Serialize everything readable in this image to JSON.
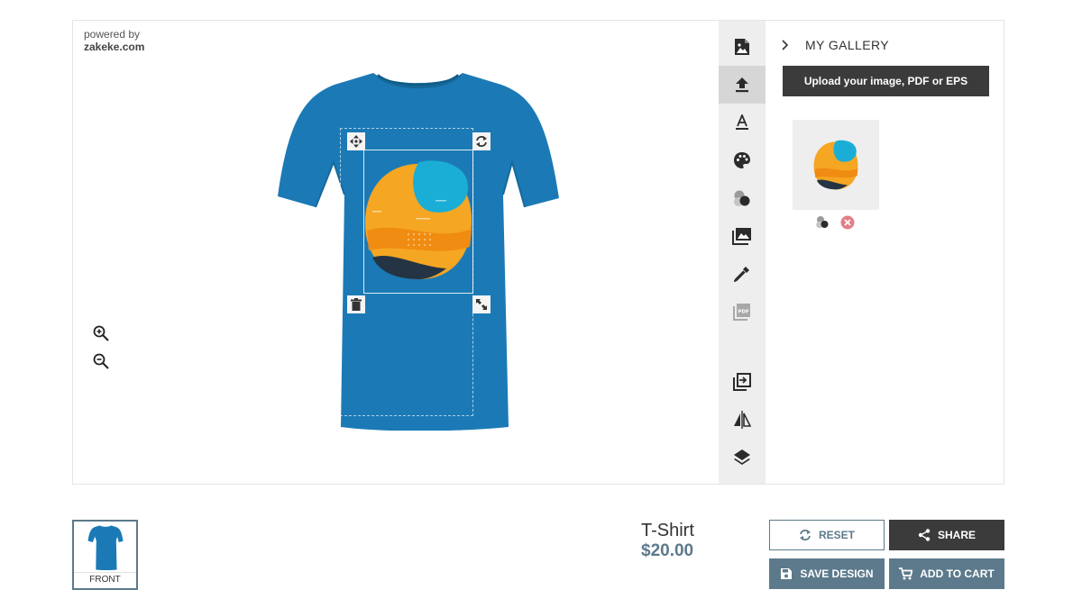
{
  "branding": {
    "powered_by": "powered by",
    "brand": "zakeke.com"
  },
  "colors": {
    "shirt": "#1b7ab6",
    "accent": "#5c7a8c",
    "dark": "#3b3b3b",
    "toolbar_bg": "#eeeeee",
    "art_orange": "#f5a623",
    "art_cyan": "#1aaed6",
    "art_navy": "#243444"
  },
  "editor": {
    "handles": [
      "move-icon",
      "rotate-icon",
      "delete-icon",
      "scale-icon"
    ],
    "zoom": [
      "zoom-in-icon",
      "zoom-out-icon"
    ]
  },
  "toolbar": {
    "tools": [
      {
        "name": "image-icon",
        "active": false
      },
      {
        "name": "upload-icon",
        "active": true
      },
      {
        "name": "text-icon",
        "active": false
      },
      {
        "name": "palette-icon",
        "active": false
      },
      {
        "name": "color-layers-icon",
        "active": false
      },
      {
        "name": "gallery-icon",
        "active": false
      },
      {
        "name": "eyedropper-icon",
        "active": false
      },
      {
        "name": "pdf-icon",
        "active": false
      },
      {
        "name": "copy-to-side-icon",
        "active": false
      },
      {
        "name": "flip-icon",
        "active": false
      },
      {
        "name": "layers-icon",
        "active": false
      }
    ]
  },
  "panel": {
    "gallery_title": "MY GALLERY",
    "upload_label": "Upload your image, PDF or EPS"
  },
  "sides": [
    {
      "label": "FRONT"
    }
  ],
  "product": {
    "name": "T-Shirt",
    "price": "$20.00"
  },
  "actions": {
    "reset": "RESET",
    "share": "SHARE",
    "save": "SAVE DESIGN",
    "cart": "ADD TO CART"
  }
}
